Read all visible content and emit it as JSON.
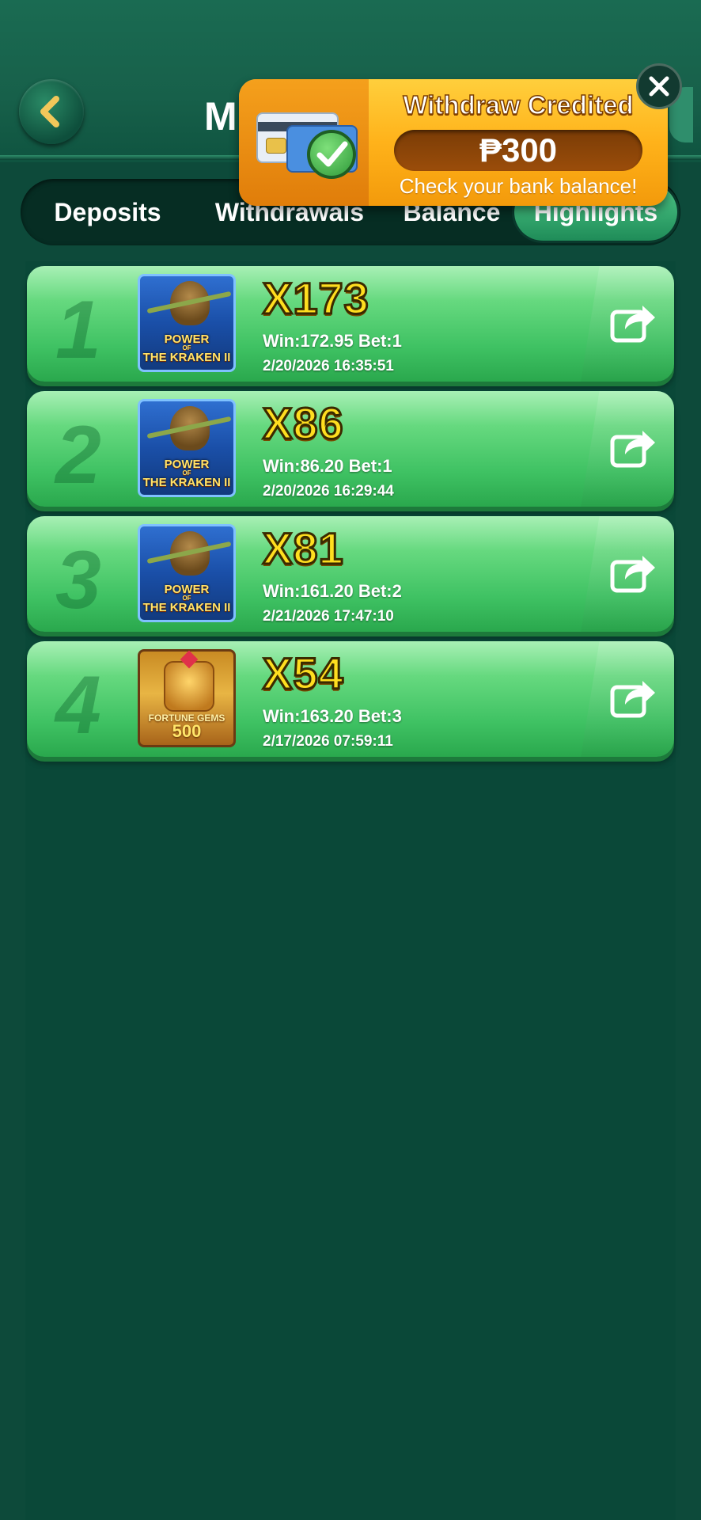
{
  "header": {
    "title": "M"
  },
  "tabs": [
    {
      "label": "Deposits"
    },
    {
      "label": "Withdrawals"
    },
    {
      "label": "Balance"
    },
    {
      "label": "Highlights"
    }
  ],
  "highlights": [
    {
      "rank": "1",
      "game": "Power of The Kraken II",
      "game_lines": [
        "POWER",
        "OF",
        "THE KRAKEN II"
      ],
      "multiplier": "X173",
      "win_bet": "Win:172.95 Bet:1",
      "date": "2/20/2026 16:35:51"
    },
    {
      "rank": "2",
      "game": "Power of The Kraken II",
      "game_lines": [
        "POWER",
        "OF",
        "THE KRAKEN II"
      ],
      "multiplier": "X86",
      "win_bet": "Win:86.20 Bet:1",
      "date": "2/20/2026 16:29:44"
    },
    {
      "rank": "3",
      "game": "Power of The Kraken II",
      "game_lines": [
        "POWER",
        "OF",
        "THE KRAKEN II"
      ],
      "multiplier": "X81",
      "win_bet": "Win:161.20 Bet:2",
      "date": "2/21/2026 17:47:10"
    },
    {
      "rank": "4",
      "game": "Fortune Gems 500",
      "game_lines": [
        "FORTUNE GEMS",
        "500"
      ],
      "multiplier": "X54",
      "win_bet": "Win:163.20 Bet:3",
      "date": "2/17/2026 07:59:11"
    }
  ],
  "toast": {
    "title": "Withdraw Credited",
    "amount": "₱300",
    "subtitle": "Check your bank balance!"
  },
  "icons": {
    "back": "chevron-left-icon",
    "share": "share-arrow-icon",
    "close": "close-icon",
    "check": "check-circle-icon",
    "card": "credit-card-icon",
    "support": "headset-icon"
  },
  "colors": {
    "accent_green": "#3fc263",
    "multiplier_yellow": "#ffde1f",
    "toast_orange": "#ffb21a"
  }
}
